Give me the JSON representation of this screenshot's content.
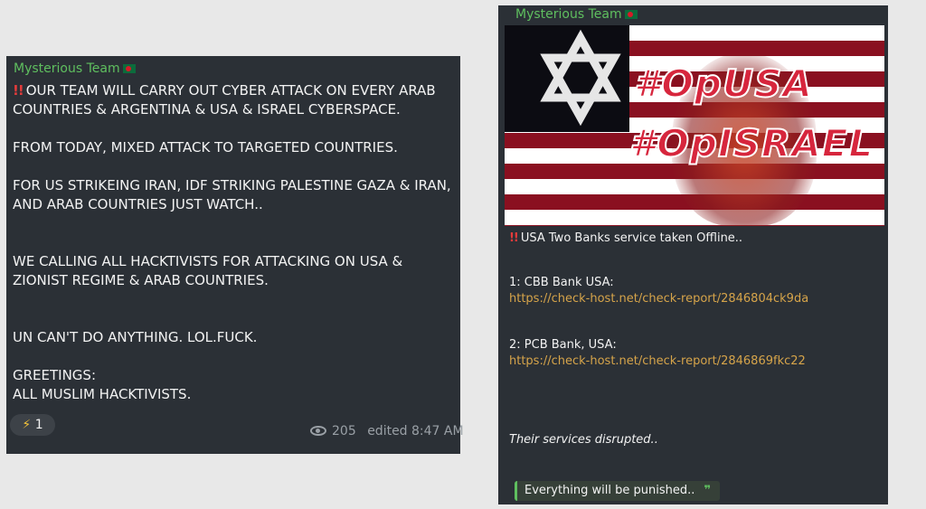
{
  "left_post": {
    "sender": "Mysterious Team",
    "lines": [
      "OUR TEAM WILL CARRY OUT CYBER ATTACK ON EVERY ARAB COUNTRIES & ARGENTINA & USA & ISRAEL CYBERSPACE.",
      "FROM TODAY, MIXED ATTACK TO TARGETED COUNTRIES.",
      "FOR  US STRIKEING IRAN, IDF STRIKING PALESTINE GAZA & IRAN, AND ARAB COUNTRIES JUST WATCH..",
      "WE CALLING ALL HACKTIVISTS FOR ATTACKING ON USA & ZIONIST REGIME & ARAB COUNTRIES.",
      "UN CAN'T DO ANYTHING. LOL.FUCK.",
      "GREETINGS:",
      "ALL MUSLIM HACKTIVISTS."
    ],
    "reaction_emoji": "⚡",
    "reaction_count": "1",
    "views": "205",
    "edited": "edited 8:47 AM"
  },
  "right_post": {
    "sender": "Mysterious Team",
    "banner_text_1": "#OpUSA",
    "banner_text_2": "#OpISRAEL",
    "headline": "USA Two Banks service taken Offline..",
    "item1_label": "1: CBB Bank USA:",
    "item1_link": "https://check-host.net/check-report/2846804ck9da",
    "item2_label": "2: PCB Bank, USA:",
    "item2_link": "https://check-host.net/check-report/2846869fkc22",
    "footer": "Their services disrupted..",
    "quote": "Everything will be punished..",
    "quote_mark": "❞"
  },
  "icons": {
    "bang": "double-exclamation-icon",
    "eye": "eye-icon",
    "flag": "bangladesh-flag-icon",
    "star": "star-of-david-icon"
  },
  "colors": {
    "panel_bg": "#2b3036",
    "sender_green": "#5fbf5f",
    "link_orange": "#d6a44a",
    "alert_red": "#e23b3b"
  }
}
